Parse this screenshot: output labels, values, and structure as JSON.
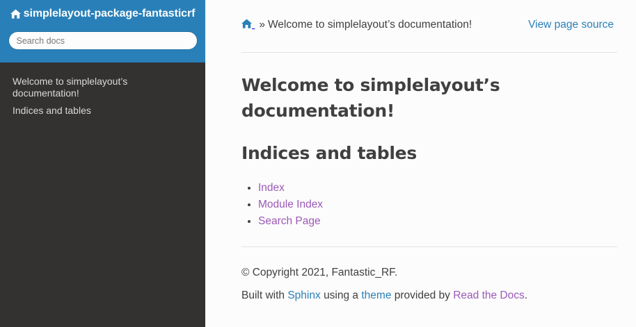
{
  "sidebar": {
    "project_name": "simplelayout-package-fantasticrf",
    "search_placeholder": "Search docs",
    "items": [
      {
        "label": "Welcome to simplelayout’s documentation!"
      },
      {
        "label": "Indices and tables"
      }
    ]
  },
  "breadcrumbs": {
    "separator": "»",
    "current": "Welcome to simplelayout’s documentation!",
    "view_source": "View page source"
  },
  "main": {
    "title": "Welcome to simplelayout’s documentation!",
    "section_title": "Indices and tables",
    "links": [
      {
        "label": "Index"
      },
      {
        "label": "Module Index"
      },
      {
        "label": "Search Page"
      }
    ]
  },
  "footer": {
    "copyright": "© Copyright 2021, Fantastic_RF.",
    "built_with": "Built with",
    "sphinx": "Sphinx",
    "using_a": "using a",
    "theme": "theme",
    "provided_by": "provided by",
    "read_the_docs": "Read the Docs",
    "period": "."
  },
  "icons": {
    "home": "home-icon"
  },
  "colors": {
    "sidebar_header": "#2980b9",
    "sidebar_bg": "#343131",
    "link_blue": "#2980b9",
    "link_visited": "#9b59b6",
    "text": "#404040"
  }
}
